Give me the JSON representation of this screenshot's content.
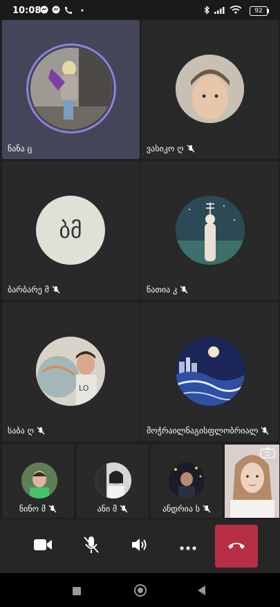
{
  "status": {
    "time": "10:08",
    "battery": "92"
  },
  "participants": {
    "p1": {
      "name": "ნანა ც"
    },
    "p2": {
      "name": "ვასიკო ღ"
    },
    "p3": {
      "name": "ბარბარე მ",
      "initials": "ბმ"
    },
    "p4": {
      "name": "ნათია კ"
    },
    "p5": {
      "name": "საბა ღ"
    },
    "p6": {
      "name": "მოჭრაილნაგისფლობრიალ"
    },
    "p7": {
      "name": "ნინო მ"
    },
    "p8": {
      "name": "ანი მ"
    },
    "p9": {
      "name": "ანდრია ს"
    }
  },
  "colors": {
    "speaking_ring": "#8b84d7",
    "hangup": "#b72f45",
    "initials_bg": "#dfe0d6"
  }
}
